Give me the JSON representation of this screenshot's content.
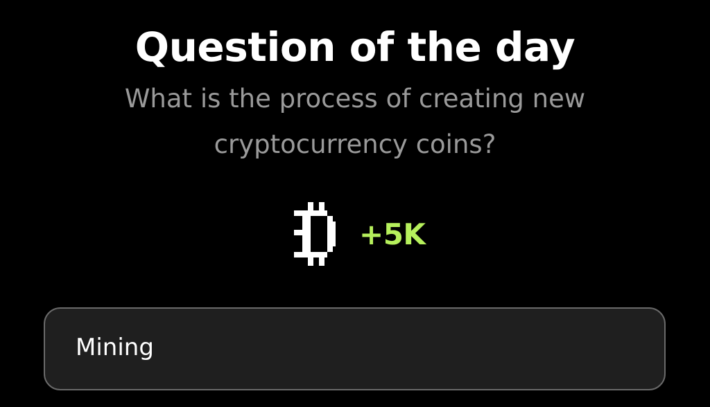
{
  "header": {
    "title": "Question of the day"
  },
  "question": {
    "text": "What is the process of creating new cryptocurrency coins?"
  },
  "reward": {
    "icon": "pixel-coin-icon",
    "amount": "+5K",
    "accent_color": "#b6f05c"
  },
  "answer": {
    "value": "Mining"
  }
}
